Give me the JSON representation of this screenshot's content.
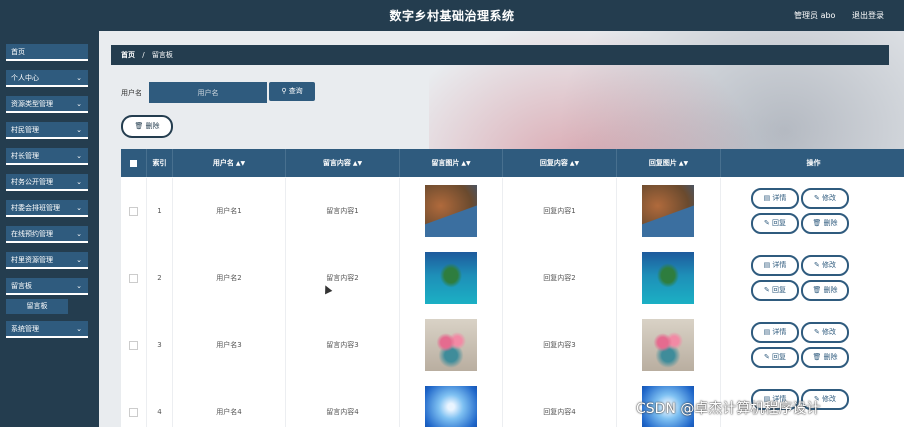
{
  "header": {
    "title": "数字乡村基础治理系统",
    "admin_label": "管理员 abo",
    "logout_label": "退出登录"
  },
  "sidebar": {
    "items": [
      {
        "label": "首页",
        "has_chevron": false
      },
      {
        "label": "个人中心",
        "has_chevron": true
      },
      {
        "label": "资源类型管理",
        "has_chevron": true
      },
      {
        "label": "村民管理",
        "has_chevron": true
      },
      {
        "label": "村长管理",
        "has_chevron": true
      },
      {
        "label": "村务公开管理",
        "has_chevron": true
      },
      {
        "label": "村委会排班管理",
        "has_chevron": true
      },
      {
        "label": "在线预约管理",
        "has_chevron": true
      },
      {
        "label": "村里资源管理",
        "has_chevron": true
      },
      {
        "label": "留言板",
        "has_chevron": true
      },
      {
        "label": "系统管理",
        "has_chevron": true
      }
    ],
    "subitem": "留言板"
  },
  "breadcrumb": {
    "home": "首页",
    "separator": "/",
    "current": "留言板"
  },
  "search": {
    "label": "用户名",
    "placeholder": "用户名",
    "button": "查询",
    "button_icon": "search-icon"
  },
  "delete_button": {
    "label": "删除",
    "icon": "trash-icon"
  },
  "table": {
    "columns": [
      "",
      "索引",
      "用户名",
      "留言内容",
      "留言图片",
      "回复内容",
      "回复图片",
      "操作"
    ],
    "sortable": [
      false,
      false,
      true,
      true,
      true,
      true,
      true,
      false
    ],
    "rows": [
      {
        "index": "1",
        "username": "用户名1",
        "message": "留言内容1",
        "reply": "回复内容1",
        "image": "coastal-cliff-village"
      },
      {
        "index": "2",
        "username": "用户名2",
        "message": "留言内容2",
        "reply": "回复内容2",
        "image": "tropical-island"
      },
      {
        "index": "3",
        "username": "用户名3",
        "message": "留言内容3",
        "reply": "回复内容3",
        "image": "flowers-in-watering-can"
      },
      {
        "index": "4",
        "username": "用户名4",
        "message": "留言内容4",
        "reply": "回复内容4",
        "image": "blue-abstract"
      }
    ],
    "actions": {
      "detail": "详情",
      "edit": "修改",
      "reply": "回复",
      "delete": "删除"
    }
  },
  "watermark": "CSDN @卓杰计算机程序设计",
  "colors": {
    "header_bg": "#243d4f",
    "accent": "#2f5b7e",
    "page_bg": "#e9ecef"
  }
}
